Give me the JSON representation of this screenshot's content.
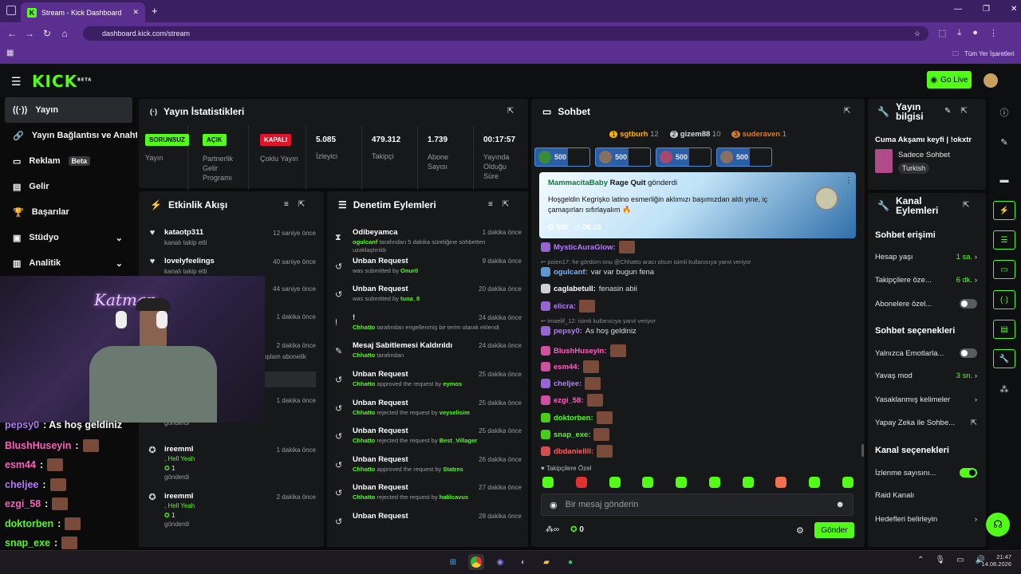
{
  "browser": {
    "tab_title": "Stream - Kick Dashboard",
    "url": "dashboard.kick.com/stream",
    "bookmarks_label": "Tüm Yer İşaretleri",
    "new_tab": "+"
  },
  "header": {
    "logo": "KICK",
    "logo_badge": "BETA",
    "go_live": "Go Live"
  },
  "sidebar": {
    "items": [
      {
        "label": "Yayın",
        "icon": "broadcast-icon"
      },
      {
        "label": "Yayın Bağlantısı ve Anahtarı",
        "icon": "link-icon"
      },
      {
        "label": "Reklam",
        "badge": "Beta",
        "icon": "ad-icon"
      },
      {
        "label": "Gelir",
        "icon": "revenue-icon"
      },
      {
        "label": "Başarılar",
        "icon": "trophy-icon"
      },
      {
        "label": "Stüdyo",
        "icon": "studio-icon"
      },
      {
        "label": "Analitik",
        "icon": "analytics-icon"
      }
    ]
  },
  "stats": {
    "title": "Yayın İstatistikleri",
    "items": [
      {
        "pill": "SORUNSUZ",
        "label": "Yayın"
      },
      {
        "pill": "AÇIK",
        "label": "Partnerlik Gelir Programı"
      },
      {
        "pill": "KAPALI",
        "label": "Çoklu Yayın"
      },
      {
        "value": "5.085",
        "label": "İzleyici"
      },
      {
        "value": "479.312",
        "label": "Takipçi"
      },
      {
        "value": "1.739",
        "label": "Abone Sayısı"
      },
      {
        "value": "00:17:57",
        "label": "Yayında Olduğu Süre"
      }
    ]
  },
  "activity": {
    "title": "Etkinlik Akışı",
    "items": [
      {
        "name": "kataotp311",
        "desc": "kanalı takip etti",
        "time": "12 saniye önce"
      },
      {
        "name": "lovelyfeelings",
        "desc": "kanalı takip etti",
        "time": "40 saniye önce"
      },
      {
        "time": "44 saniye önce"
      },
      {
        "time": "1 dakika önce"
      },
      {
        "time": "2 dakika önce",
        "desc": "oplam abonelik"
      },
      {
        "time": "1 dakika önce",
        "desc": "gönderdi",
        "count": "1"
      },
      {
        "name": "ireemml",
        "desc": ", Hell Yeah",
        "count": "1",
        "sent": "gönderdi",
        "time": "1 dakika önce"
      },
      {
        "name": "ireemml",
        "desc": ", Hell Yeah",
        "count": "1",
        "sent": "gönderdi",
        "time": "2 dakika önce"
      }
    ]
  },
  "moderation": {
    "title": "Denetim Eylemleri",
    "items": [
      {
        "title": "Odibeyamca",
        "sub_user": "ogulcanf",
        "sub": " tarafından 5 dakika süreliğine sohbetten uzaklaştırıldı",
        "time": "1 dakika önce"
      },
      {
        "title": "Unban Request",
        "sub": "was submitted by ",
        "sub_user": "Onur0",
        "time": "9 dakika önce"
      },
      {
        "title": "Unban Request",
        "sub": "was submitted by ",
        "sub_user": "tuna_8",
        "time": "20 dakika önce"
      },
      {
        "title": "!",
        "sub_user": "Chhatto",
        "sub": " tarafından engellenmiş bir terim olarak eklendi",
        "time": "24 dakika önce"
      },
      {
        "title": "Mesaj Sabitlemesi Kaldırıldı",
        "sub_user": "Chhatto",
        "sub": " tarafından",
        "time": "24 dakika önce"
      },
      {
        "title": "Unban Request",
        "sub_user": "Chhatto",
        "sub": " approved the request by ",
        "target": "eymos",
        "time": "25 dakika önce"
      },
      {
        "title": "Unban Request",
        "sub_user": "Chhatto",
        "sub": " rejected the request by ",
        "target": "veyselisim",
        "time": "25 dakika önce"
      },
      {
        "title": "Unban Request",
        "sub_user": "Chhatto",
        "sub": " rejected the request by ",
        "target": "Best_Villager",
        "time": "25 dakika önce"
      },
      {
        "title": "Unban Request",
        "sub_user": "Chhatto",
        "sub": " approved the request by ",
        "target": "Statres",
        "time": "26 dakika önce"
      },
      {
        "title": "Unban Request",
        "sub_user": "Chhatto",
        "sub": " rejected the request by ",
        "target": "halilcavus",
        "time": "27 dakika önce"
      },
      {
        "title": "Unban Request",
        "time": "28 dakika önce"
      }
    ]
  },
  "chat": {
    "title": "Sohbet",
    "top_gifters": [
      {
        "rank": "1",
        "name": "sgtburh",
        "count": "12"
      },
      {
        "rank": "2",
        "name": "gizem88",
        "count": "10"
      },
      {
        "rank": "3",
        "name": "suderaven",
        "count": "1"
      }
    ],
    "kicks_chips": [
      "500",
      "500",
      "500",
      "500"
    ],
    "pinned": {
      "user": "MammacitaBaby",
      "gift": "Rage Quit",
      "sent": "gönderdi",
      "message": "Hoşgeldin Kegrişko latino esmerliğin aklımızı başımızdan aldı yine, iç çamaşırları sıfırlayalım 🔥",
      "amount": "500",
      "timer": "06:26"
    },
    "messages": [
      {
        "user": "MysticAuraGlow:",
        "color": "#b57bff"
      },
      {
        "reply": "poien17: he gördüm onu @Chhatto aracı olsun",
        "reply2": "isimli kullanıcıya yanıt veriyor"
      },
      {
        "user": "ogulcanf:",
        "color": "#6fb6ff",
        "text": "var var bugun fena"
      },
      {
        "user": "caglabetull:",
        "color": "#ffffff",
        "text": "fenasin abii"
      },
      {
        "user": "elicra:",
        "color": "#b57bff"
      },
      {
        "reply": "imaelif_12:",
        "reply2": "isimli kullanıcıya yanıt veriyor"
      },
      {
        "user": "pepsy0:",
        "color": "#b57bff",
        "text": "As hoş geldiniz"
      },
      {
        "user": "BlushHuseyin:",
        "color": "#ff5fc2"
      },
      {
        "user": "esm44:",
        "color": "#ff5fc2"
      },
      {
        "user": "cheljee:",
        "color": "#b57bff"
      },
      {
        "user": "ezgi_58:",
        "color": "#ff5fc2"
      },
      {
        "user": "doktorben:",
        "color": "#53fc18"
      },
      {
        "user": "snap_exe:",
        "color": "#53fc18"
      },
      {
        "user": "dbdaniellll:",
        "color": "#ff5f5f"
      }
    ],
    "followers_label": "Takipçilere Özel",
    "input_placeholder": "Bir mesaj gönderin",
    "send": "Gönder",
    "kicks_count": "0"
  },
  "info": {
    "title": "Yayın bilgisi",
    "stream_title": "Cuma Akşamı keyfi | !okxtr",
    "category": "Sadece Sohbet",
    "language": "Turkish"
  },
  "channel_actions": {
    "title": "Kanal Eylemleri",
    "chat_access": "Sohbet erişimi",
    "account_age": {
      "label": "Hesap yaşı",
      "value": "1 sa."
    },
    "followers_only": {
      "label": "Takipçilere öze...",
      "value": "6 dk."
    },
    "subs_only": {
      "label": "Abonelere özel..."
    },
    "chat_options": "Sohbet seçenekleri",
    "emotes_only": {
      "label": "Yalnızca Emotlarla..."
    },
    "slow_mode": {
      "label": "Yavaş mod",
      "value": "3 sn."
    },
    "banned_words": {
      "label": "Yasaklanmış kelimeler"
    },
    "ai": {
      "label": "Yapay Zeka ile Sohbe..."
    },
    "channel_options": "Kanal seçenekleri",
    "viewer_count": {
      "label": "İzlenme sayısını..."
    },
    "raid": {
      "label": "Raid Kanalı"
    },
    "goals": {
      "label": "Hedefleri belirleyin"
    }
  },
  "webcam": {
    "neon": "Katman",
    "chat": [
      {
        "user": "pepsy0",
        "text": ": As hoş geldiniz",
        "color": "#b57bff"
      },
      {
        "user": "BlushHuseyin",
        "text": " :",
        "color": "#ff5fc2"
      },
      {
        "user": "esm44",
        "text": " :",
        "color": "#ff5fc2"
      },
      {
        "user": "cheljee",
        "text": " :",
        "color": "#b57bff"
      },
      {
        "user": "ezgi_58",
        "text": " :",
        "color": "#ff5fc2"
      },
      {
        "user": "doktorben",
        "text": " :",
        "color": "#53fc18"
      },
      {
        "user": "snap_exe",
        "text": " :",
        "color": "#53fc18"
      },
      {
        "user": "dbdaniellll",
        "text": " :",
        "color": "#ff5f5f"
      }
    ]
  },
  "taskbar": {
    "time": "21:47",
    "date": "14.08.2026"
  }
}
